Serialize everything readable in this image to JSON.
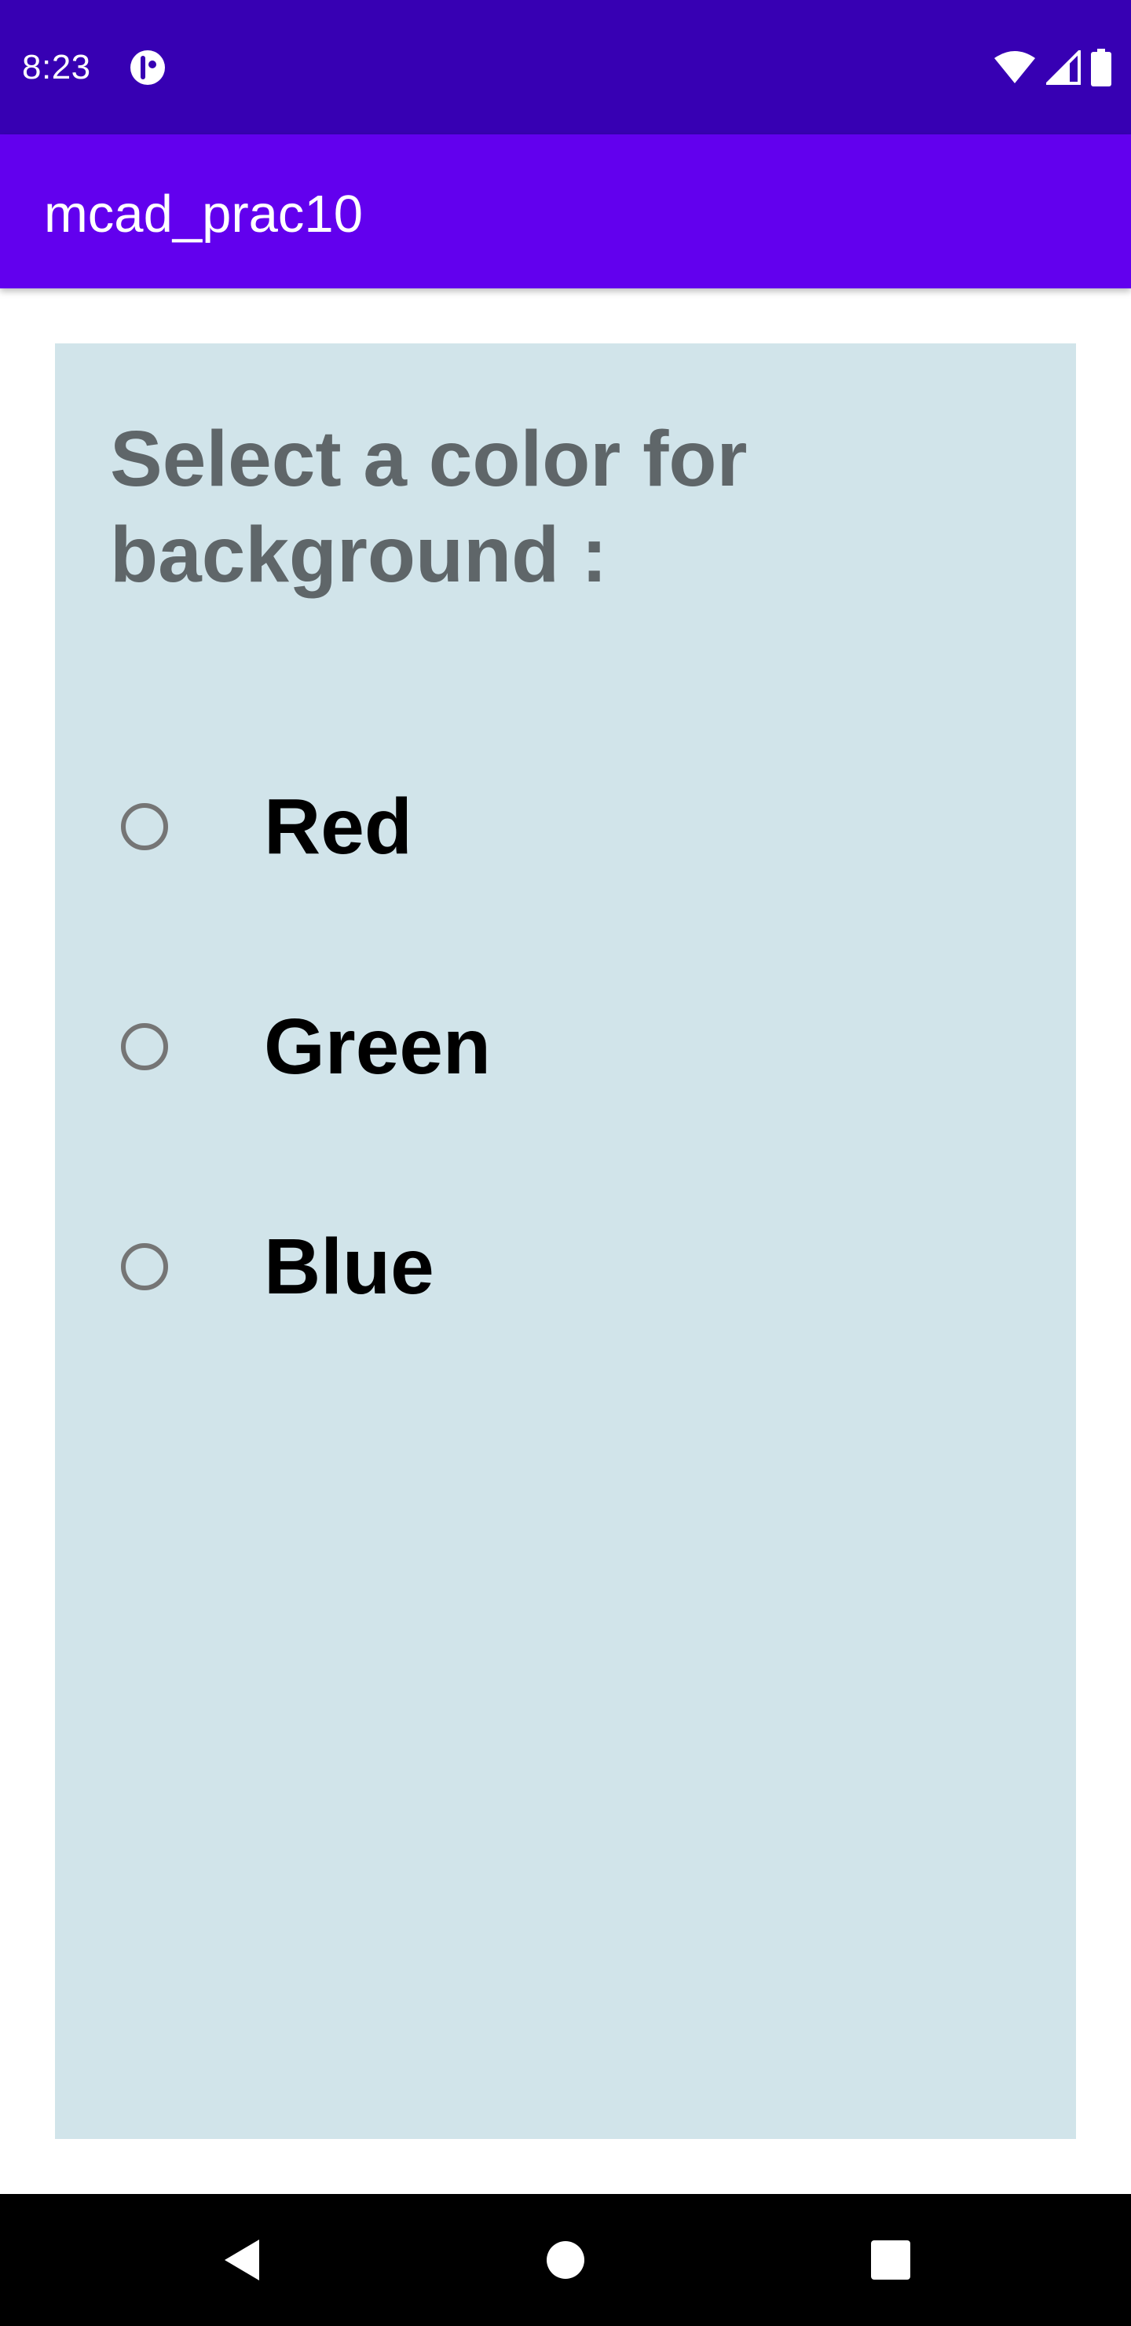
{
  "status_bar": {
    "time": "8:23",
    "icons": [
      "app-notification-icon",
      "wifi-icon",
      "signal-icon",
      "battery-icon"
    ],
    "background_color": "#3700b3"
  },
  "app_bar": {
    "title": "mcad_prac10",
    "background_color": "#6200ee"
  },
  "panel": {
    "background_color": "#d1e4ea",
    "prompt": "Select a color for background :",
    "options": [
      {
        "label": "Red",
        "selected": false
      },
      {
        "label": "Green",
        "selected": false
      },
      {
        "label": "Blue",
        "selected": false
      }
    ]
  },
  "nav_bar": {
    "buttons": [
      "back-icon",
      "home-icon",
      "recents-icon"
    ]
  }
}
